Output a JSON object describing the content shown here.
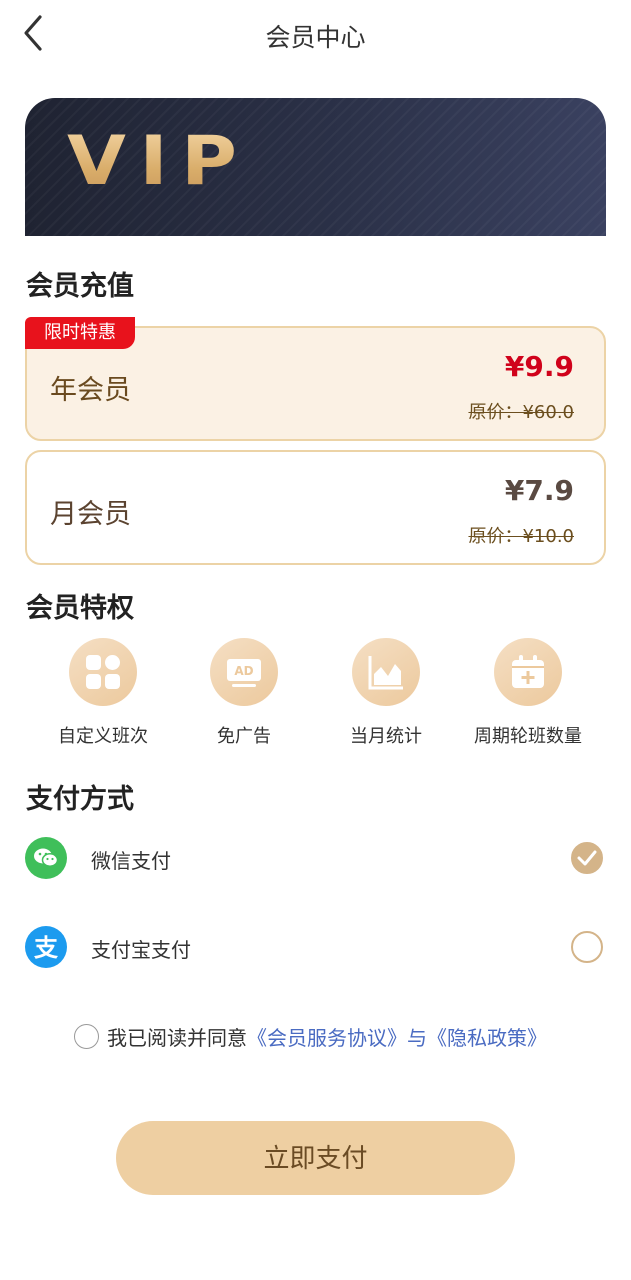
{
  "header": {
    "title": "会员中心"
  },
  "banner": {
    "logo_text": "VIP"
  },
  "recharge": {
    "section_title": "会员充值",
    "badge": "限时特惠",
    "plans": [
      {
        "name": "年会员",
        "price": "¥9.9",
        "original": "原价：¥60.0",
        "selected": true
      },
      {
        "name": "月会员",
        "price": "¥7.9",
        "original": "原价：¥10.0",
        "selected": false
      }
    ]
  },
  "privileges": {
    "section_title": "会员特权",
    "items": [
      {
        "label": "自定义班次",
        "icon": "grid-apps-icon"
      },
      {
        "label": "免广告",
        "icon": "ad-icon"
      },
      {
        "label": "当月统计",
        "icon": "area-chart-icon"
      },
      {
        "label": "周期轮班数量",
        "icon": "calendar-add-icon"
      }
    ]
  },
  "payment": {
    "section_title": "支付方式",
    "methods": [
      {
        "label": "微信支付",
        "icon": "wechat-icon",
        "color": "#3fbf5a",
        "checked": true
      },
      {
        "label": "支付宝支付",
        "icon": "alipay-icon",
        "color": "#1c9bef",
        "checked": false
      }
    ]
  },
  "agreement": {
    "prefix": "我已阅读并同意",
    "service_link": "《会员服务协议》",
    "connector": "与",
    "privacy_link": "《隐私政策》",
    "checked": false
  },
  "pay_button": {
    "label": "立即支付"
  },
  "colors": {
    "accent": "#d4b489",
    "price_red": "#d0021b",
    "link": "#4a6bc2",
    "button": "#eecfa2"
  }
}
